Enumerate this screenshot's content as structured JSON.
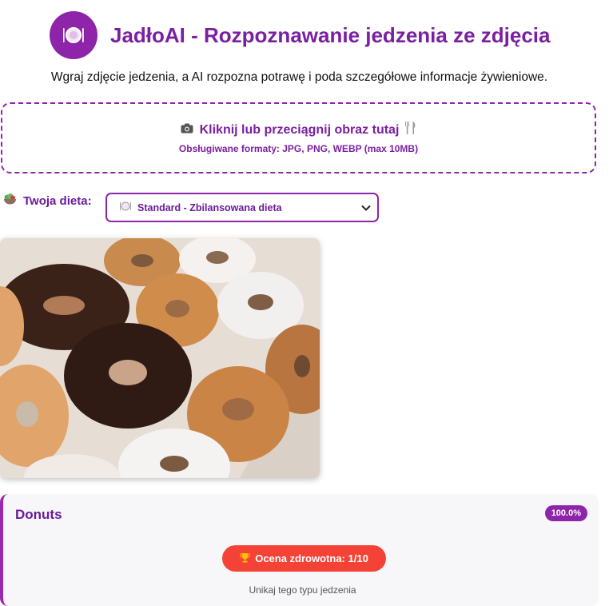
{
  "header": {
    "title": "JadłoAI - Rozpoznawanie jedzenia ze zdjęcia",
    "subtitle": "Wgraj zdjęcie jedzenia, a AI rozpozna potrawę i poda szczegółowe informacje żywieniowe.",
    "logo_icon": "plate-cutlery-icon"
  },
  "upload": {
    "label": "Kliknij lub przeciągnij obraz tutaj",
    "formats": "Obsługiwane formaty: JPG, PNG, WEBP (max 10MB)",
    "icons": [
      "camera-icon",
      "fork-knife-icon"
    ]
  },
  "diet": {
    "label": "Twoja dieta:",
    "selected": "Standard - Zbilansowana dieta"
  },
  "photo": {
    "subject": "donuts-photo"
  },
  "result": {
    "name": "Donuts",
    "confidence": "100.0%",
    "health_label": "Ocena zdrowotna: 1/10",
    "advice": "Unikaj tego typu jedzenia"
  },
  "colors": {
    "accent": "#8e24aa",
    "title": "#7b1fa2",
    "health_bad": "#f44336",
    "card_bg": "#f7f7f9"
  }
}
